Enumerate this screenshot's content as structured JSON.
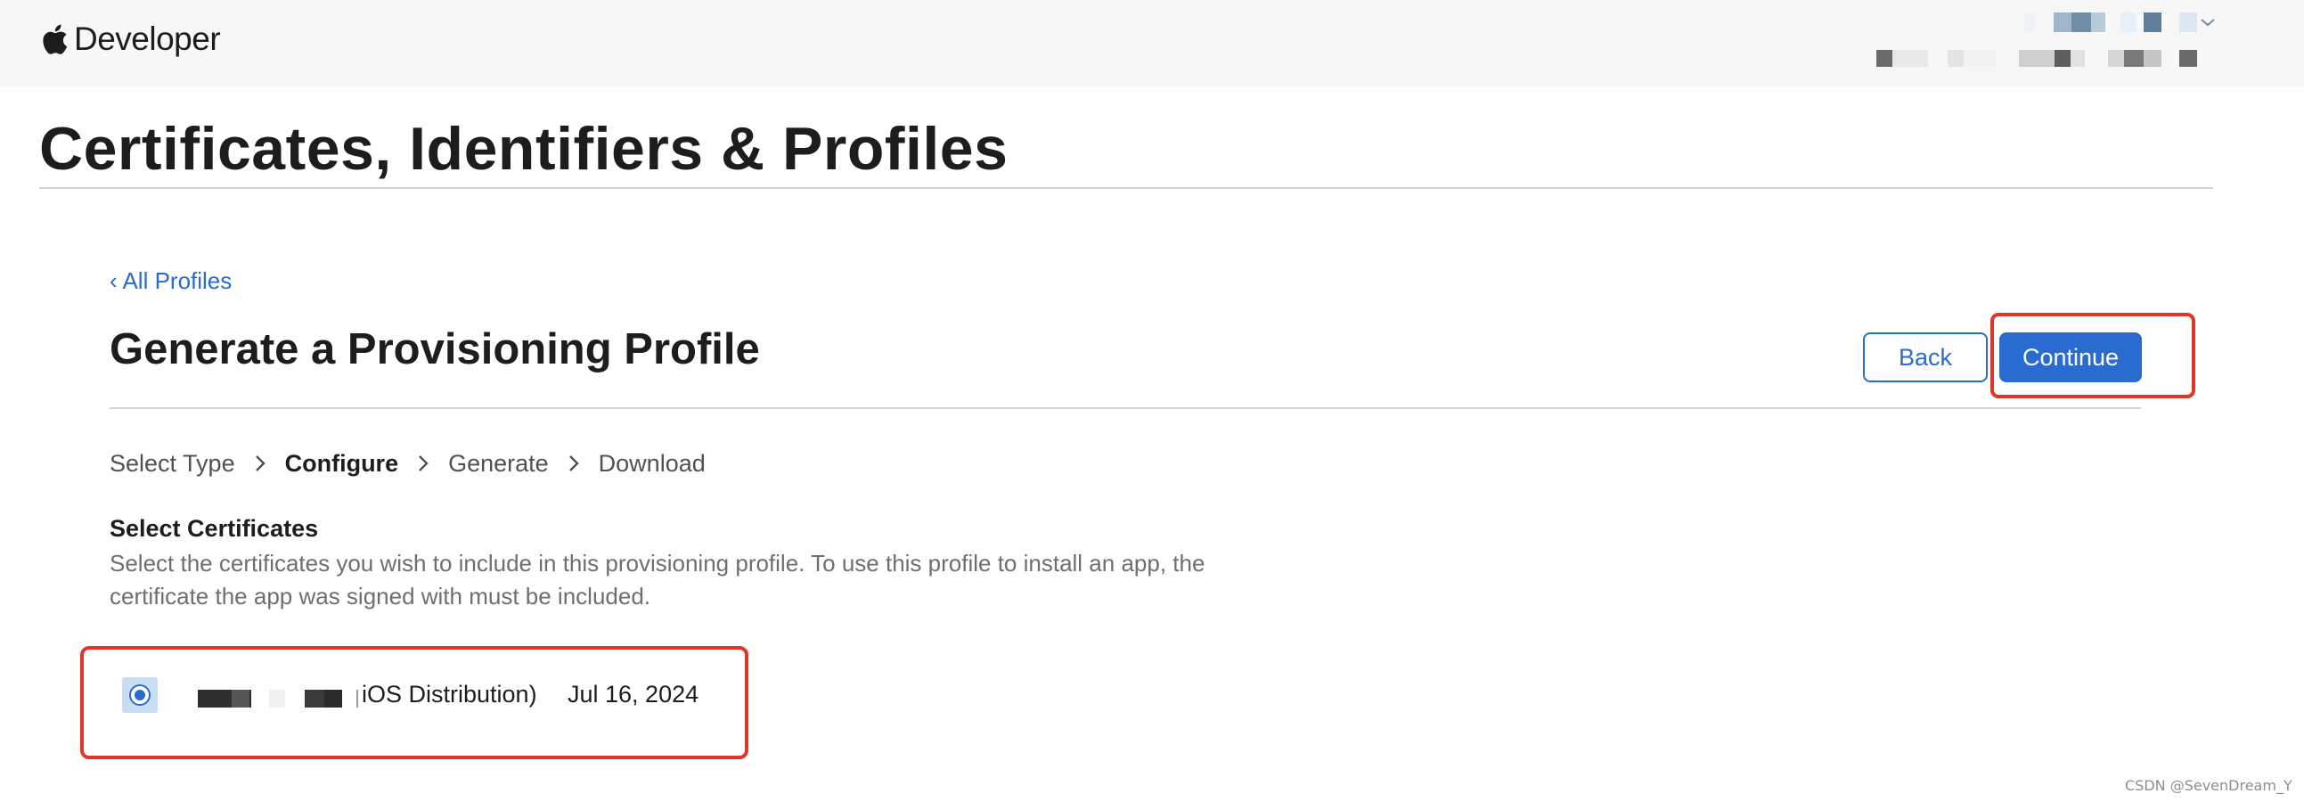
{
  "header": {
    "brand_label": "Developer",
    "logo_icon": "apple-logo-icon"
  },
  "page": {
    "title": "Certificates, Identifiers & Profiles"
  },
  "nav": {
    "back_link": "‹ All Profiles"
  },
  "section": {
    "title": "Generate a Provisioning Profile",
    "back_button": "Back",
    "continue_button": "Continue"
  },
  "steps": [
    {
      "label": "Select Type",
      "current": false
    },
    {
      "label": "Configure",
      "current": true
    },
    {
      "label": "Generate",
      "current": false
    },
    {
      "label": "Download",
      "current": false
    }
  ],
  "certificates": {
    "heading": "Select Certificates",
    "description": "Select the certificates you wish to include in this provisioning profile. To use this profile to install an app, the certificate the app was signed with must be included.",
    "items": [
      {
        "name_suffix": "iOS Distribution)",
        "date": "Jul 16, 2024",
        "selected": true
      }
    ]
  },
  "watermark": "CSDN @SevenDream_Y",
  "colors": {
    "accent": "#2a6bd0",
    "highlight": "#e0352b",
    "topbar_bg": "#f7f7f7"
  }
}
